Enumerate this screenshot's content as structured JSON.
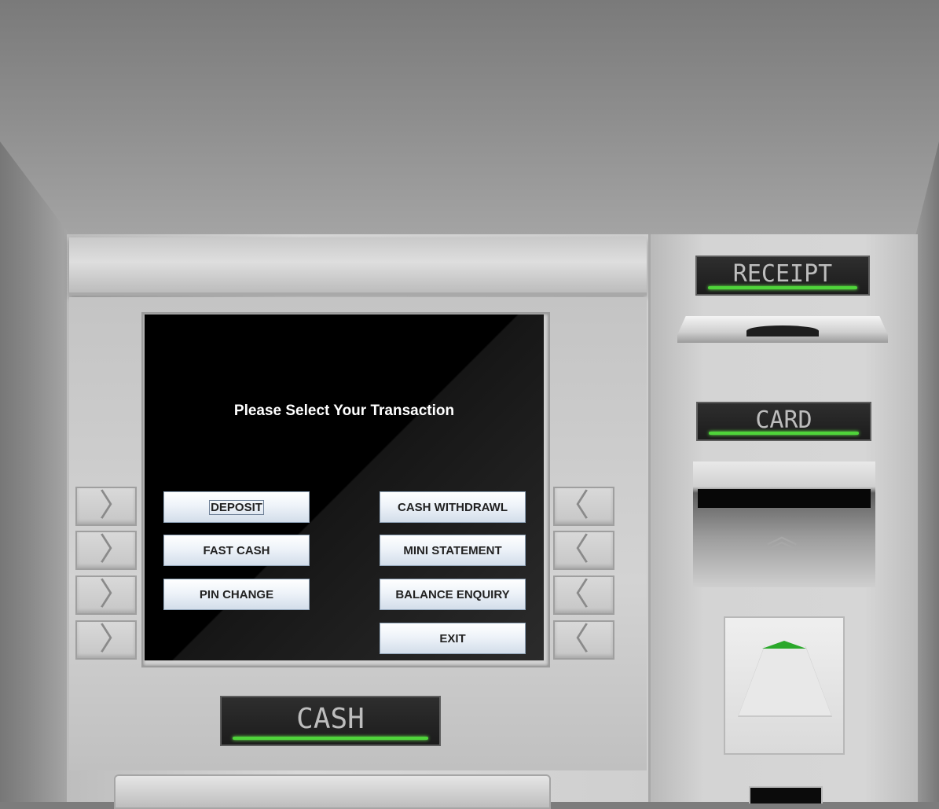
{
  "screen": {
    "title": "Please Select Your Transaction",
    "left_buttons": [
      "DEPOSIT",
      "FAST CASH",
      "PIN CHANGE"
    ],
    "right_buttons": [
      "CASH WITHDRAWL",
      "MINI STATEMENT",
      "BALANCE ENQUIRY",
      "EXIT"
    ],
    "focused_button": "DEPOSIT"
  },
  "labels": {
    "receipt": "RECEIPT",
    "card": "CARD",
    "cash": "CASH"
  },
  "icons": {
    "left_key_arrow": "chevron-right-icon",
    "right_key_arrow": "chevron-left-icon",
    "card_insert": "double-chevron-up-icon"
  },
  "colors": {
    "lcd_indicator": "#4fd43a",
    "screen_bg": "#000000",
    "button_text": "#222222"
  }
}
